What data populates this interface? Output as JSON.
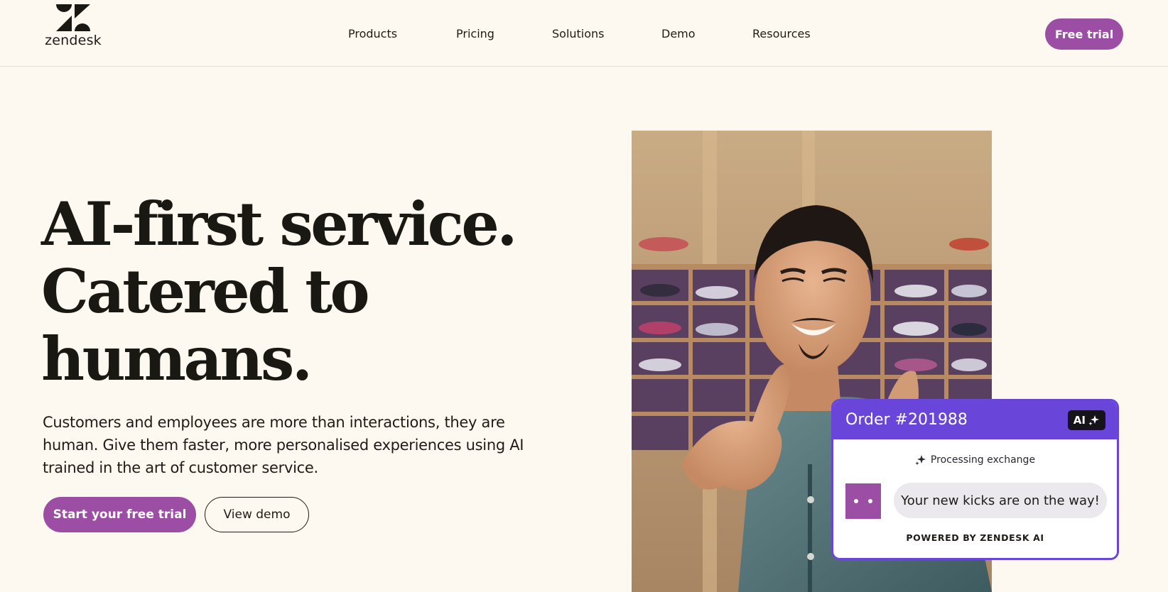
{
  "brand": {
    "logo_text": "zendesk",
    "colors": {
      "background": "#fef9f0",
      "primary_purple": "#9b4ea3",
      "card_accent": "#6a45d9",
      "text": "#1f1c17"
    }
  },
  "nav": {
    "items": [
      {
        "label": "Products"
      },
      {
        "label": "Pricing"
      },
      {
        "label": "Solutions"
      },
      {
        "label": "Demo"
      },
      {
        "label": "Resources"
      }
    ],
    "cta_label": "Free trial"
  },
  "hero": {
    "title_lines": [
      "AI-first service.",
      "Catered to",
      "humans."
    ],
    "subtitle": "Customers and employees are more than interactions, they are human. Give them faster, more personalised experiences using AI trained in the art of customer service.",
    "primary_button": "Start your free trial",
    "secondary_button": "View demo"
  },
  "chat_card": {
    "order_title": "Order #201988",
    "ai_badge": "AI",
    "status": "Processing exchange",
    "message": "Your new kicks are on the way!",
    "footer": "POWERED BY ZENDESK AI",
    "icons": [
      "sparkle-icon",
      "bot-avatar-icon"
    ]
  }
}
